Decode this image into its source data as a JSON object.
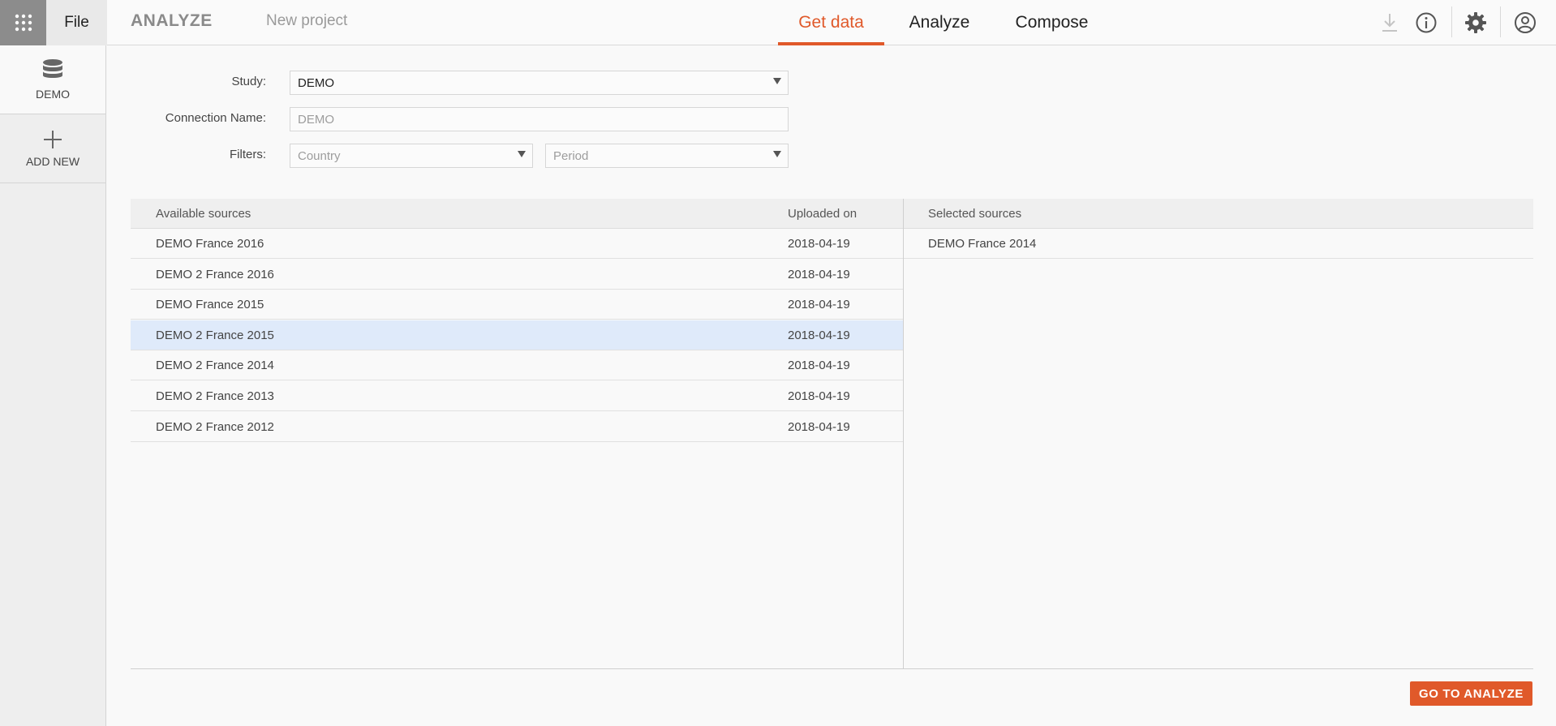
{
  "header": {
    "file_label": "File",
    "app_name": "ANALYZE",
    "project_name": "New project",
    "tabs": [
      {
        "label": "Get data",
        "active": true
      },
      {
        "label": "Analyze",
        "active": false
      },
      {
        "label": "Compose",
        "active": false
      }
    ],
    "icons": [
      "apps-grid-icon",
      "download-icon",
      "info-icon",
      "gear-icon",
      "user-account-icon"
    ]
  },
  "sidebar": {
    "items": [
      {
        "label": "DEMO",
        "icon": "database-icon",
        "active": true
      },
      {
        "label": "ADD NEW",
        "icon": "plus-icon",
        "active": false
      }
    ]
  },
  "form": {
    "study_label": "Study:",
    "study_value": "DEMO",
    "connection_label": "Connection Name:",
    "connection_placeholder": "DEMO",
    "filters_label": "Filters:",
    "country_placeholder": "Country",
    "period_placeholder": "Period"
  },
  "available": {
    "header_name": "Available sources",
    "header_date": "Uploaded on",
    "rows": [
      {
        "name": "DEMO France 2016",
        "date": "2018-04-19",
        "selected": false
      },
      {
        "name": "DEMO 2 France 2016",
        "date": "2018-04-19",
        "selected": false
      },
      {
        "name": "DEMO France 2015",
        "date": "2018-04-19",
        "selected": false
      },
      {
        "name": "DEMO 2 France 2015",
        "date": "2018-04-19",
        "selected": true
      },
      {
        "name": "DEMO 2 France 2014",
        "date": "2018-04-19",
        "selected": false
      },
      {
        "name": "DEMO 2 France 2013",
        "date": "2018-04-19",
        "selected": false
      },
      {
        "name": "DEMO 2 France 2012",
        "date": "2018-04-19",
        "selected": false
      }
    ]
  },
  "selected": {
    "header_name": "Selected sources",
    "rows": [
      {
        "name": "DEMO France 2014"
      }
    ]
  },
  "actions": {
    "go_label": "GO TO ANALYZE"
  },
  "colors": {
    "accent": "#e0592a",
    "selected_row": "#dfeafa"
  }
}
